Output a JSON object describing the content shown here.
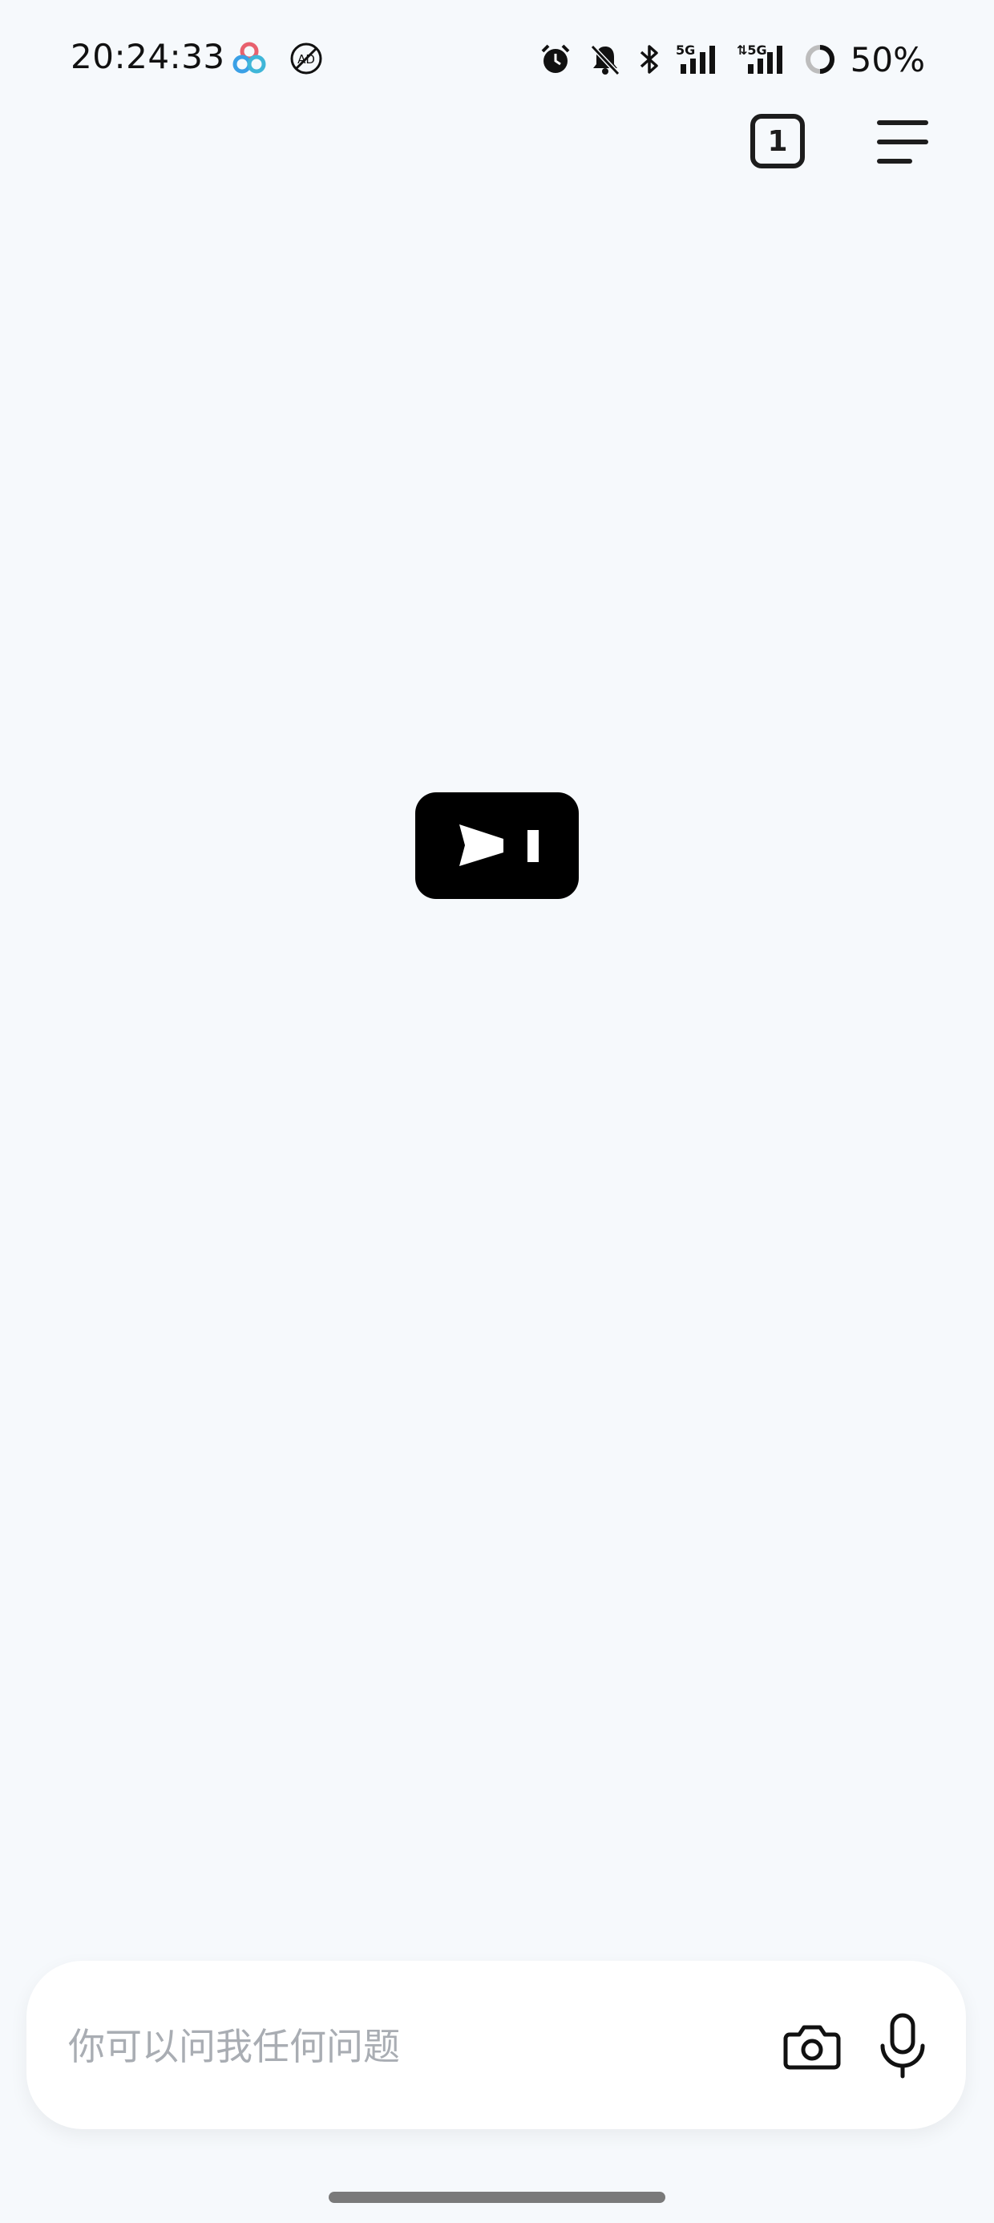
{
  "status_bar": {
    "time": "20:24:33",
    "battery": "50%",
    "icons": [
      "app-notification-icon",
      "ad-block-icon",
      "alarm-icon",
      "mute-bell-icon",
      "bluetooth-icon",
      "5g-signal-icon",
      "5g-signal-2-icon",
      "battery-icon"
    ]
  },
  "toolbar": {
    "tab_count": "1",
    "menu_icon": "hamburger-menu-icon"
  },
  "logo": {
    "icon": "terminal-prompt-logo"
  },
  "input": {
    "placeholder": "你可以问我任何问题",
    "value": "",
    "camera_icon": "camera-icon",
    "mic_icon": "microphone-icon"
  },
  "colors": {
    "background": "#f6f9fc",
    "logo": "#000000",
    "placeholder": "#a9adb3"
  }
}
